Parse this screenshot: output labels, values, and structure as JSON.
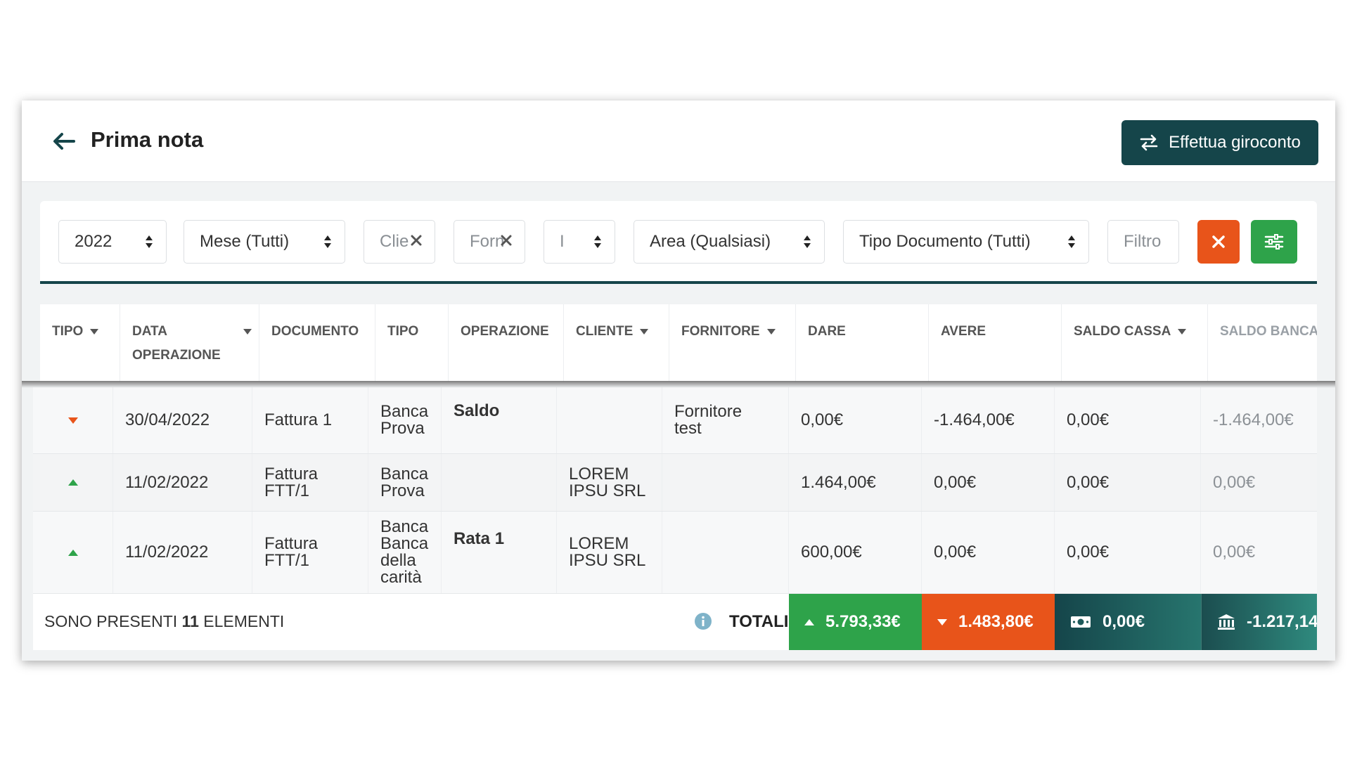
{
  "header": {
    "title": "Prima nota",
    "giroconto_label": "Effettua giroconto"
  },
  "filters": {
    "year": "2022",
    "month": "Mese (Tutti)",
    "cliente_placeholder": "Clie",
    "fornitore_placeholder": "Forn",
    "small_select": "I",
    "area": "Area (Qualsiasi)",
    "tipo_documento": "Tipo Documento (Tutti)",
    "filtro_placeholder": "Filtro"
  },
  "table": {
    "columns": [
      "TIPO",
      "DATA",
      "DOCUMENTO",
      "TIPO",
      "OPERAZIONE",
      "CLIENTE",
      "FORNITORE",
      "DARE",
      "AVERE",
      "SALDO CASSA",
      "SALDO BANCA"
    ],
    "data_sub": "OPERAZIONE",
    "rows": [
      {
        "direction": "down",
        "data": "30/04/2022",
        "documento": [
          "Fattura 1"
        ],
        "tipo": [
          "Banca",
          "Prova"
        ],
        "operazione": "Saldo",
        "cliente": [],
        "fornitore": [
          "Fornitore",
          "test"
        ],
        "dare": "0,00€",
        "avere": "-1.464,00€",
        "saldo_cassa": "0,00€",
        "saldo_banca": "-1.464,00€"
      },
      {
        "direction": "up",
        "data": "11/02/2022",
        "documento": [
          "Fattura",
          "FTT/1"
        ],
        "tipo": [
          "Banca",
          "Prova"
        ],
        "operazione": "",
        "cliente": [
          "LOREM",
          "IPSU SRL"
        ],
        "fornitore": [],
        "dare": "1.464,00€",
        "avere": "0,00€",
        "saldo_cassa": "0,00€",
        "saldo_banca": "0,00€"
      },
      {
        "direction": "up",
        "data": "11/02/2022",
        "documento": [
          "Fattura",
          "FTT/1"
        ],
        "tipo": [
          "Banca",
          "Banca",
          "della",
          "carità"
        ],
        "operazione": "Rata 1",
        "cliente": [
          "LOREM",
          "IPSU SRL"
        ],
        "fornitore": [],
        "dare": "600,00€",
        "avere": "0,00€",
        "saldo_cassa": "0,00€",
        "saldo_banca": "0,00€"
      }
    ]
  },
  "footer": {
    "count_prefix": "SONO PRESENTI",
    "count": "11",
    "count_suffix": "ELEMENTI",
    "totals_label": "TOTALI:",
    "total_dare": "5.793,33€",
    "total_avere": "1.483,80€",
    "total_cassa": "0,00€",
    "total_banca": "-1.217,14"
  },
  "colors": {
    "primary": "#15454a",
    "green": "#2ea34a",
    "orange": "#e8541a",
    "teal_dark": "#1b4d4f",
    "teal_gradient_end": "#2f8a7e"
  }
}
